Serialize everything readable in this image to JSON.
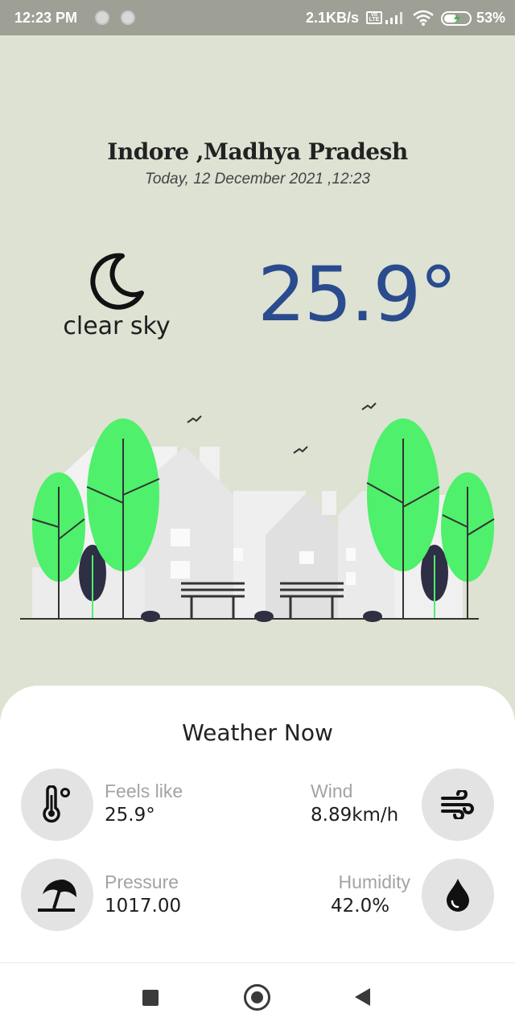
{
  "status_bar": {
    "time": "12:23 PM",
    "network_speed": "2.1KB/s",
    "volte": "Vo LTE",
    "battery_percent": "53%",
    "battery_level": 0.53,
    "icons": [
      "notification-dot-icon",
      "notification-dot-icon",
      "signal-icon",
      "wifi-icon",
      "battery-charging-icon"
    ]
  },
  "location": {
    "city": "Indore ,Madhya Pradesh",
    "datetime": "Today, 12 December 2021 ,12:23"
  },
  "current": {
    "condition_icon": "moon-icon",
    "condition": "clear sky",
    "temperature": "25.9°",
    "accent_color": "#2a4b8d"
  },
  "weather_now": {
    "title": "Weather Now",
    "metrics": [
      {
        "name": "feels-like",
        "label": "Feels like",
        "value": "25.9°",
        "icon": "thermometer-icon"
      },
      {
        "name": "wind",
        "label": "Wind",
        "value": "8.89km/h",
        "icon": "wind-icon"
      },
      {
        "name": "pressure",
        "label": "Pressure",
        "value": "1017.00",
        "icon": "beach-umbrella-icon"
      },
      {
        "name": "humidity",
        "label": "Humidity",
        "value": "42.0%",
        "icon": "water-drop-icon"
      }
    ]
  },
  "nav_bar": {
    "buttons": [
      "recents-button",
      "home-button",
      "back-button"
    ]
  },
  "colors": {
    "background": "#dde2d3",
    "tree_green": "#4ff06c",
    "card": "#ffffff"
  }
}
